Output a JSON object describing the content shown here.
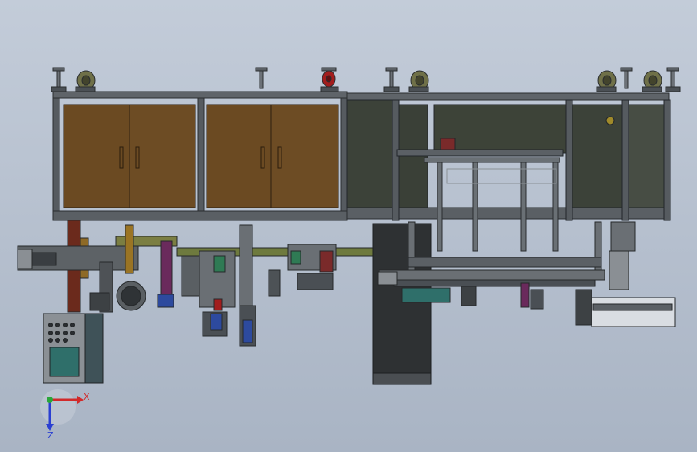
{
  "triad": {
    "x_label": "X",
    "z_label": "Z"
  },
  "colors": {
    "background_top": "#c3ccd9",
    "background_bottom": "#a9b4c4",
    "frame": "#4d5257",
    "cabinet_wood": "#6b4a22",
    "cabinet_panel": "#3c4239",
    "pallet_dark": "#2e3133",
    "accent_green": "#2f6f6a",
    "accent_red": "#b51f1f",
    "accent_blue": "#2d4a9e",
    "x_axis": "#d22a2a",
    "y_axis": "#2aa63a",
    "z_axis": "#2a3fd2"
  }
}
